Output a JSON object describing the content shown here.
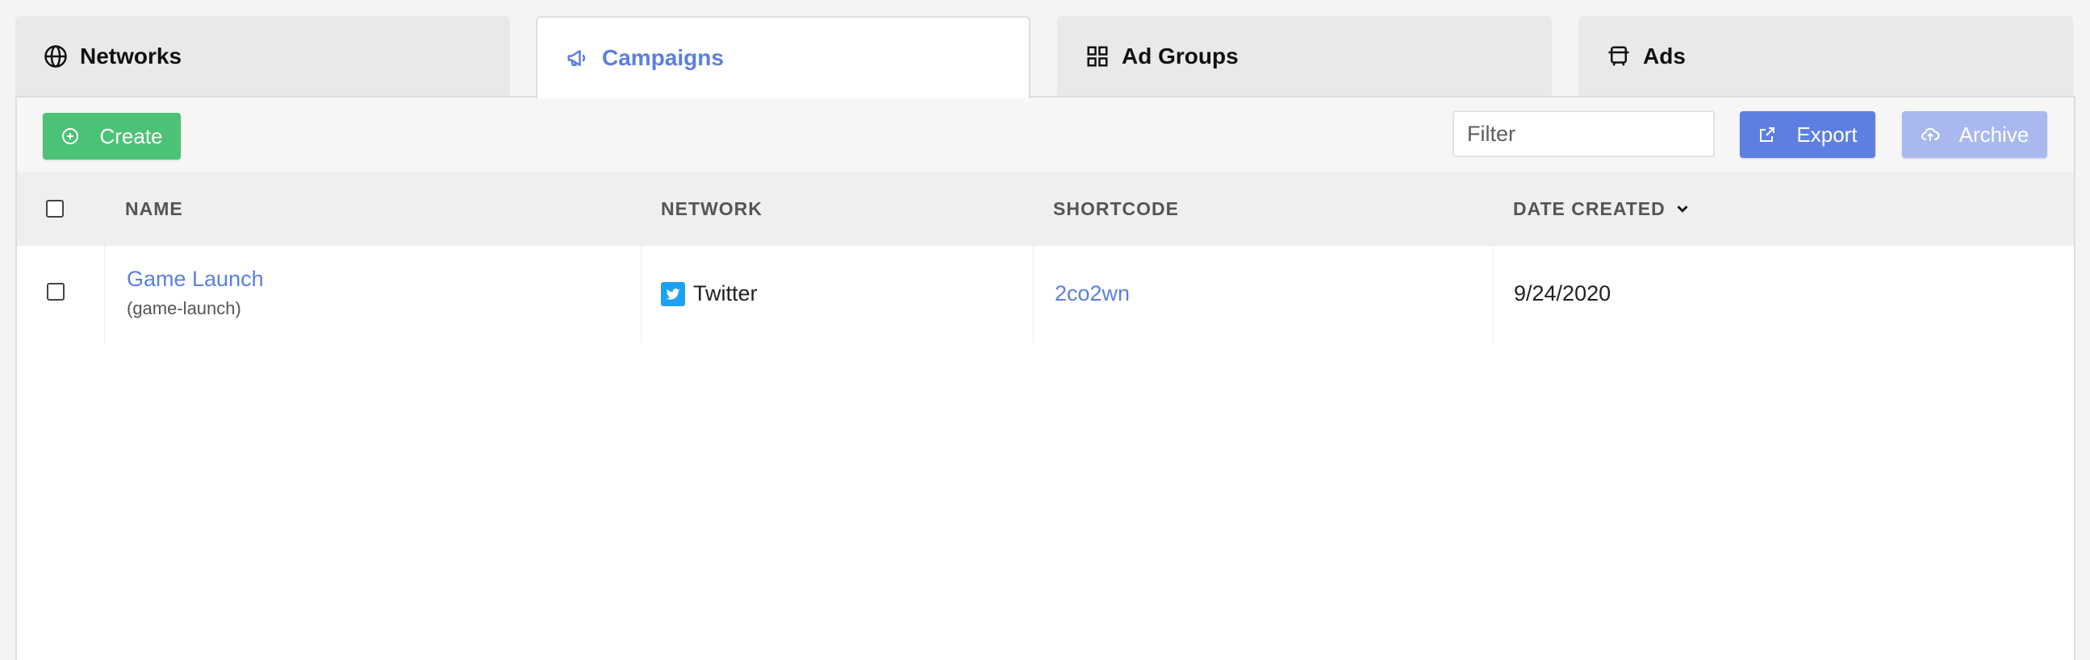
{
  "tabs": [
    {
      "label": "Networks",
      "icon": "globe-icon"
    },
    {
      "label": "Campaigns",
      "icon": "megaphone-icon"
    },
    {
      "label": "Ad Groups",
      "icon": "grid-icon"
    },
    {
      "label": "Ads",
      "icon": "ads-icon"
    }
  ],
  "active_tab": "Campaigns",
  "colors": {
    "accent": "#5b7fe0",
    "create": "#4cc276",
    "export": "#5e7fe2",
    "archive": "#a9b9ef",
    "twitter": "#1da1f2"
  },
  "toolbar": {
    "create_label": "Create",
    "filter_placeholder": "Filter",
    "export_label": "Export",
    "archive_label": "Archive"
  },
  "table": {
    "headers": {
      "name": "NAME",
      "network": "NETWORK",
      "shortcode": "SHORTCODE",
      "date_created": "DATE CREATED"
    },
    "rows": [
      {
        "name": "Game Launch",
        "slug": "(game-launch)",
        "network": "Twitter",
        "shortcode": "2co2wn",
        "date_created": "9/24/2020"
      }
    ]
  }
}
